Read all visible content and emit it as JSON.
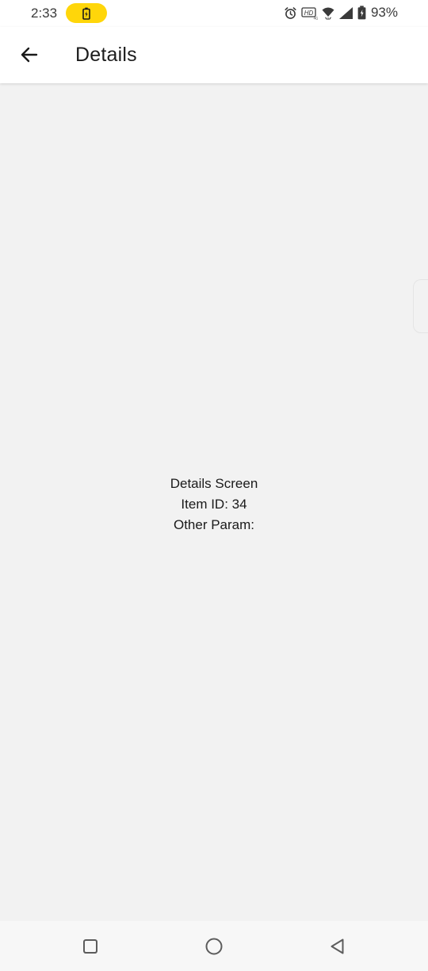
{
  "status_bar": {
    "time": "2:33",
    "battery_percent": "93%",
    "charging_pill_color": "#ffd60a",
    "icons": [
      "charging-battery-icon",
      "alarm-icon",
      "hd-volte-icon",
      "wifi-icon",
      "signal-icon",
      "battery-icon"
    ]
  },
  "app_bar": {
    "back_icon": "arrow-left-icon",
    "title": "Details"
  },
  "content": {
    "line_1": "Details Screen",
    "line_2": "Item ID: 34",
    "line_3": "Other Param:"
  },
  "nav_bar": {
    "icons": [
      "recents-square-icon",
      "home-circle-icon",
      "back-triangle-icon"
    ]
  }
}
